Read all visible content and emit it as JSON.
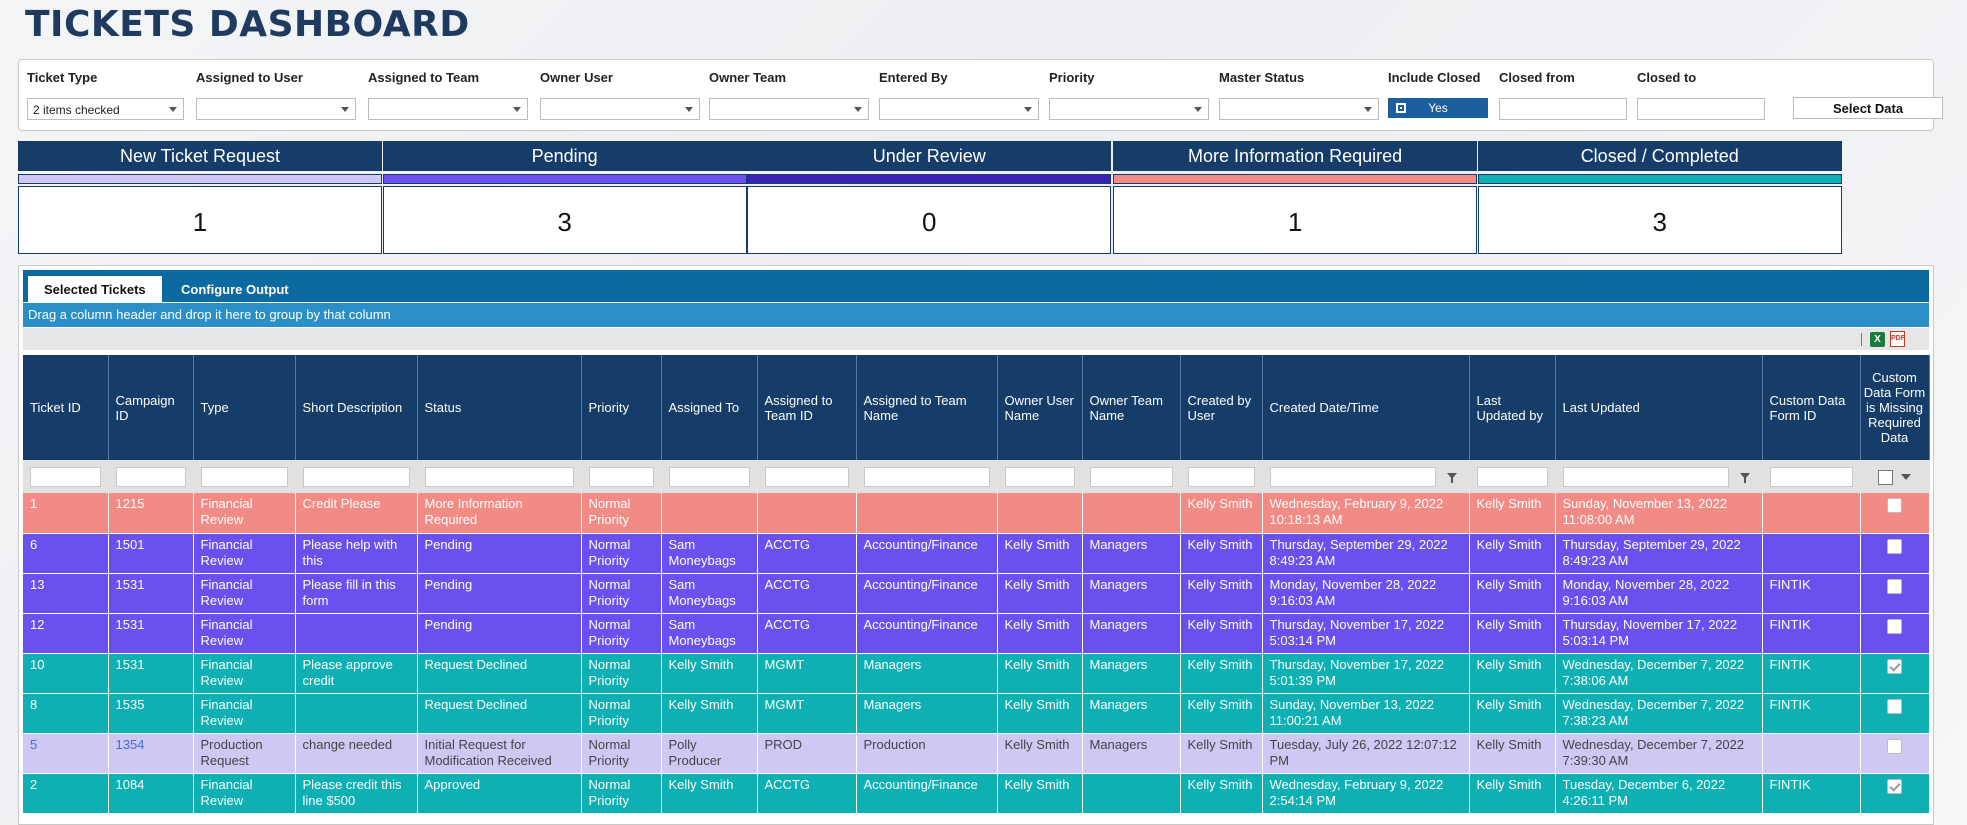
{
  "page": {
    "title": "TICKETS DASHBOARD"
  },
  "filters": {
    "ticket_type": {
      "label": "Ticket Type",
      "value": "2 items checked"
    },
    "assigned_user": {
      "label": "Assigned to User",
      "value": ""
    },
    "assigned_team": {
      "label": "Assigned to Team",
      "value": ""
    },
    "owner_user": {
      "label": "Owner User",
      "value": ""
    },
    "owner_team": {
      "label": "Owner Team",
      "value": ""
    },
    "entered_by": {
      "label": "Entered By",
      "value": ""
    },
    "priority": {
      "label": "Priority",
      "value": ""
    },
    "master_status": {
      "label": "Master Status",
      "value": ""
    },
    "include_closed": {
      "label": "Include Closed",
      "value": "Yes"
    },
    "closed_from": {
      "label": "Closed from",
      "value": ""
    },
    "closed_to": {
      "label": "Closed to",
      "value": ""
    },
    "select_button": "Select Data"
  },
  "status_cards": [
    {
      "label": "New Ticket Request",
      "count": "1",
      "color": "#cfc8f4"
    },
    {
      "label": "Pending",
      "count": "3",
      "color": "#6b50f0"
    },
    {
      "label": "Under Review",
      "count": "0",
      "color": "#3a22b8"
    },
    {
      "label": "More Information Required",
      "count": "1",
      "color": "#f28b85"
    },
    {
      "label": "Closed / Completed",
      "count": "3",
      "color": "#0fb0b3"
    }
  ],
  "tabs": [
    {
      "label": "Selected Tickets",
      "active": true
    },
    {
      "label": "Configure Output",
      "active": false
    }
  ],
  "group_hint": "Drag a column header and drop it here to group by that column",
  "toolbar": {
    "excel_icon": "excel-export-icon",
    "excel_glyph": "X",
    "pdf_icon": "pdf-export-icon",
    "pdf_glyph": "PDF"
  },
  "columns": [
    "Ticket ID",
    "Campaign ID",
    "Type",
    "Short Description",
    "Status",
    "Priority",
    "Assigned To",
    "Assigned to Team ID",
    "Assigned to Team Name",
    "Owner User Name",
    "Owner Team Name",
    "Created by User",
    "Created Date/Time",
    "Last Updated by",
    "Last Updated",
    "Custom Data Form ID",
    "Custom Data Form is Missing Required Data"
  ],
  "rows": [
    {
      "style": "red",
      "ticket_id": "1",
      "campaign_id": "1215",
      "type": "Financial Review",
      "short_description": "Credit Please",
      "status": "More Information Required",
      "priority": "Normal Priority",
      "assigned_to": "",
      "team_id": "",
      "team_name": "",
      "owner_user": "",
      "owner_team": "",
      "created_by": "Kelly Smith",
      "created": "Wednesday, February 9, 2022 10:18:13 AM",
      "last_updated_by": "Kelly Smith",
      "last_updated": "Sunday, November 13, 2022 11:08:00 AM",
      "form_id": "",
      "missing": false
    },
    {
      "style": "purple",
      "ticket_id": "6",
      "campaign_id": "1501",
      "type": "Financial Review",
      "short_description": "Please help with this",
      "status": "Pending",
      "priority": "Normal Priority",
      "assigned_to": "Sam Moneybags",
      "team_id": "ACCTG",
      "team_name": "Accounting/Finance",
      "owner_user": "Kelly Smith",
      "owner_team": "Managers",
      "created_by": "Kelly Smith",
      "created": "Thursday, September 29, 2022 8:49:23 AM",
      "last_updated_by": "Kelly Smith",
      "last_updated": "Thursday, September 29, 2022 8:49:23 AM",
      "form_id": "",
      "missing": false
    },
    {
      "style": "purple",
      "ticket_id": "13",
      "campaign_id": "1531",
      "type": "Financial Review",
      "short_description": "Please fill in this form",
      "status": "Pending",
      "priority": "Normal Priority",
      "assigned_to": "Sam Moneybags",
      "team_id": "ACCTG",
      "team_name": "Accounting/Finance",
      "owner_user": "Kelly Smith",
      "owner_team": "Managers",
      "created_by": "Kelly Smith",
      "created": "Monday, November 28, 2022 9:16:03 AM",
      "last_updated_by": "Kelly Smith",
      "last_updated": "Monday, November 28, 2022 9:16:03 AM",
      "form_id": "FINTIK",
      "missing": false
    },
    {
      "style": "purple",
      "ticket_id": "12",
      "campaign_id": "1531",
      "type": "Financial Review",
      "short_description": "",
      "status": "Pending",
      "priority": "Normal Priority",
      "assigned_to": "Sam Moneybags",
      "team_id": "ACCTG",
      "team_name": "Accounting/Finance",
      "owner_user": "Kelly Smith",
      "owner_team": "Managers",
      "created_by": "Kelly Smith",
      "created": "Thursday, November 17, 2022 5:03:14 PM",
      "last_updated_by": "Kelly Smith",
      "last_updated": "Thursday, November 17, 2022 5:03:14 PM",
      "form_id": "FINTIK",
      "missing": false
    },
    {
      "style": "teal",
      "ticket_id": "10",
      "campaign_id": "1531",
      "type": "Financial Review",
      "short_description": "Please approve credit",
      "status": "Request Declined",
      "priority": "Normal Priority",
      "assigned_to": "Kelly Smith",
      "team_id": "MGMT",
      "team_name": "Managers",
      "owner_user": "Kelly Smith",
      "owner_team": "Managers",
      "created_by": "Kelly Smith",
      "created": "Thursday, November 17, 2022 5:01:39 PM",
      "last_updated_by": "Kelly Smith",
      "last_updated": "Wednesday, December 7, 2022 7:38:06 AM",
      "form_id": "FINTIK",
      "missing": true
    },
    {
      "style": "teal",
      "ticket_id": "8",
      "campaign_id": "1535",
      "type": "Financial Review",
      "short_description": "",
      "status": "Request Declined",
      "priority": "Normal Priority",
      "assigned_to": "Kelly Smith",
      "team_id": "MGMT",
      "team_name": "Managers",
      "owner_user": "Kelly Smith",
      "owner_team": "Managers",
      "created_by": "Kelly Smith",
      "created": "Sunday, November 13, 2022 11:00:21 AM",
      "last_updated_by": "Kelly Smith",
      "last_updated": "Wednesday, December 7, 2022 7:38:23 AM",
      "form_id": "FINTIK",
      "missing": false
    },
    {
      "style": "lav",
      "ticket_id": "5",
      "campaign_id": "1354",
      "type": "Production Request",
      "short_description": "change needed",
      "status": "Initial Request for Modification Received",
      "priority": "Normal Priority",
      "assigned_to": "Polly Producer",
      "team_id": "PROD",
      "team_name": "Production",
      "owner_user": "Kelly Smith",
      "owner_team": "Managers",
      "created_by": "Kelly Smith",
      "created": "Tuesday, July 26, 2022 12:07:12 PM",
      "last_updated_by": "Kelly Smith",
      "last_updated": "Wednesday, December 7, 2022 7:39:30 AM",
      "form_id": "",
      "missing": false
    },
    {
      "style": "teal",
      "ticket_id": "2",
      "campaign_id": "1084",
      "type": "Financial Review",
      "short_description": "Please credit this line $500",
      "status": "Approved",
      "priority": "Normal Priority",
      "assigned_to": "Kelly Smith",
      "team_id": "ACCTG",
      "team_name": "Accounting/Finance",
      "owner_user": "Kelly Smith",
      "owner_team": "",
      "created_by": "Kelly Smith",
      "created": "Wednesday, February 9, 2022 2:54:14 PM",
      "last_updated_by": "Kelly Smith",
      "last_updated": "Tuesday, December 6, 2022 4:26:11 PM",
      "form_id": "FINTIK",
      "missing": true
    }
  ]
}
